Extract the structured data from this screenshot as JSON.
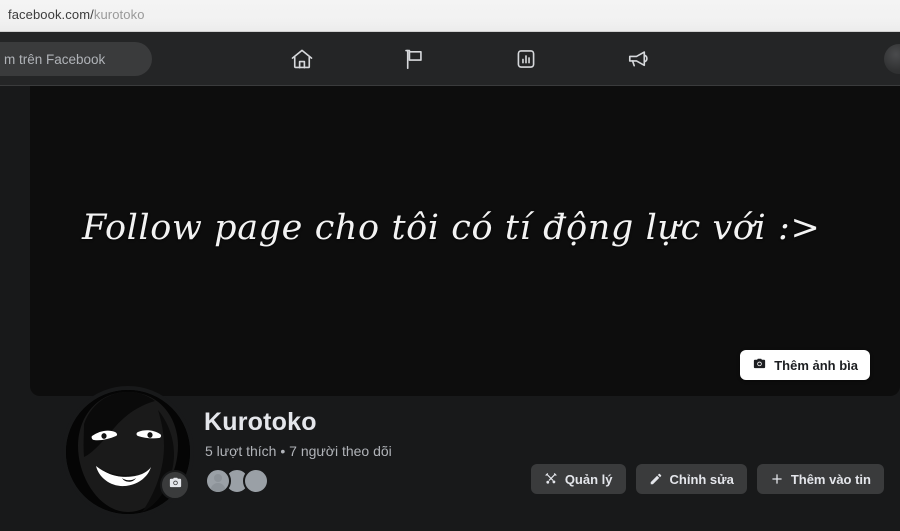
{
  "browser": {
    "url_domain": "facebook.com/",
    "url_path": "kurotoko"
  },
  "nav": {
    "search_text": "m trên Facebook",
    "search_placeholder": "Tìm kiếm trên Facebook",
    "items": [
      {
        "name": "home-icon",
        "label": "Trang chủ"
      },
      {
        "name": "pages-flag-icon",
        "label": "Trang"
      },
      {
        "name": "insights-chart-icon",
        "label": "Bảng tin"
      },
      {
        "name": "ads-megaphone-icon",
        "label": "Quảng cáo"
      }
    ],
    "avatar_name": "account-avatar"
  },
  "cover": {
    "text": "Follow page cho tôi có tí động lực với :>",
    "add_cover_label": "Thêm ảnh bìa",
    "camera_icon": "camera-icon"
  },
  "profile": {
    "name": "Kurotoko",
    "stats": "5 lượt thích • 7 người theo dõi",
    "likes_count": "5",
    "followers_count": "7",
    "avatar_camera_icon": "camera-icon",
    "facepile": [
      {
        "name": "follower-avatar-generic"
      },
      {
        "name": "follower-avatar-anime-1"
      },
      {
        "name": "follower-avatar-anime-2"
      }
    ]
  },
  "actions": [
    {
      "label": "Quản lý",
      "icon": "tools-icon"
    },
    {
      "label": "Chỉnh sửa",
      "icon": "pencil-icon"
    },
    {
      "label": "Thêm vào tin",
      "icon": "plus-icon"
    }
  ]
}
